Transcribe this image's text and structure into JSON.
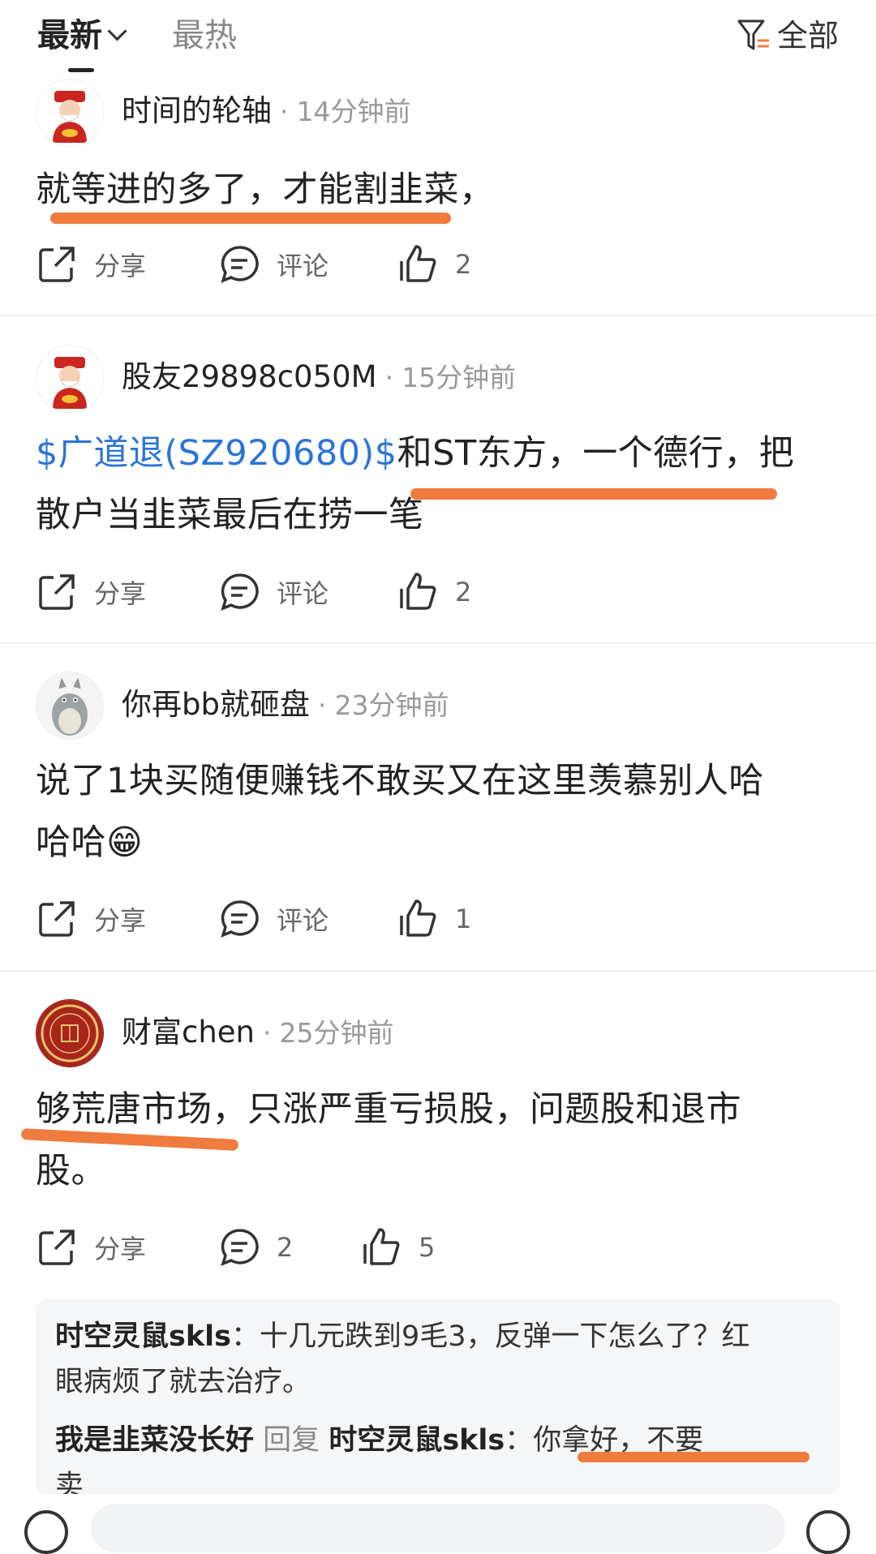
{
  "header": {
    "tab_latest": "最新",
    "tab_hot": "最热",
    "filter_label": "全部"
  },
  "posts": [
    {
      "username": "时间的轮轴",
      "time": "14分钟前",
      "text": "就等进的多了，才能割韭菜，",
      "share": "分享",
      "comment": "评论",
      "likes": "2"
    },
    {
      "username": "股友29898c050M",
      "time": "15分钟前",
      "stock_link": "$广道退(SZ920680)$",
      "text_line1": "和ST东方，一个德行，把",
      "text_line2": "散户当韭菜最后在捞一笔",
      "share": "分享",
      "comment": "评论",
      "likes": "2"
    },
    {
      "username": "你再bb就砸盘",
      "time": "23分钟前",
      "text_line1": "说了1块买随便赚钱不敢买又在这里羡慕别人哈",
      "text_line2": "哈哈😁",
      "share": "分享",
      "comment": "评论",
      "likes": "1"
    },
    {
      "username": "财富chen",
      "time": "25分钟前",
      "text_line1": "够荒唐市场，只涨严重亏损股，问题股和退市",
      "text_line2": "股。",
      "share": "分享",
      "comment": "2",
      "likes": "5"
    }
  ],
  "replies": [
    {
      "name": "时空灵鼠skls",
      "separator": "：",
      "text": "十几元跌到9毛3，反弹一下怎么了？红",
      "text_cont": "眼病烦了就去治疗。"
    },
    {
      "name": "我是韭菜没长好",
      "reply_word": "回复",
      "target": "时空灵鼠skls",
      "separator": "：",
      "text": "你拿好，不要",
      "text_cont": "卖"
    }
  ],
  "colors": {
    "accent_link": "#2b74d8",
    "highlight_marker": "#f07b3f"
  }
}
